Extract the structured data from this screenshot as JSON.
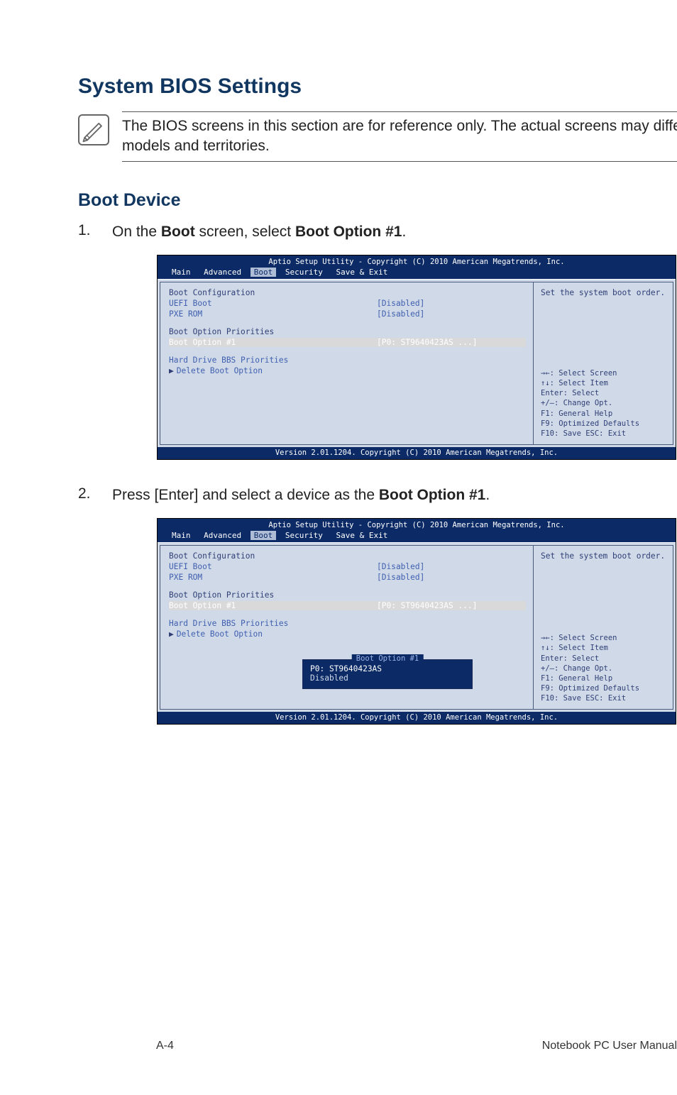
{
  "section_title": "System BIOS Settings",
  "note_text": "The BIOS screens in this section are for reference only. The actual screens may differ by models and territories.",
  "sub_title": "Boot Device",
  "steps": {
    "s1_num": "1.",
    "s1_pre": "On the ",
    "s1_b1": "Boot",
    "s1_mid": " screen, select ",
    "s1_b2": "Boot Option #1",
    "s1_post": ".",
    "s2_num": "2.",
    "s2_pre": "Press [Enter] and select a device as the ",
    "s2_b1": "Boot Option #1",
    "s2_post": "."
  },
  "bios": {
    "header": "Aptio Setup Utility - Copyright (C) 2010 American Megatrends, Inc.",
    "tabs": {
      "main": "Main",
      "advanced": "Advanced",
      "boot": "Boot",
      "security": "Security",
      "save": "Save & Exit"
    },
    "labels": {
      "boot_config": "Boot Configuration",
      "uefi_boot": "UEFI Boot",
      "pxe_rom": "PXE ROM",
      "priorities": "Boot Option Priorities",
      "boot_opt1": "Boot Option #1",
      "hard_drive_bbs": "Hard Drive BBS Priorities",
      "delete_boot": "Delete Boot Option"
    },
    "values": {
      "disabled": "[Disabled]",
      "boot_opt1_val": "[P0: ST9640423AS  ...]"
    },
    "side_text": "Set the system boot order.",
    "keys": {
      "k1": "→←: Select Screen",
      "k2": "↑↓:   Select Item",
      "k3": "Enter: Select",
      "k4": "+/—:  Change Opt.",
      "k5": "F1:   General Help",
      "k6": "F9:   Optimized Defaults",
      "k7": "F10:  Save   ESC: Exit"
    },
    "footer": "Version 2.01.1204. Copyright (C) 2010 American Megatrends, Inc.",
    "popup": {
      "title": "Boot Option #1",
      "opt1": "P0: ST9640423AS",
      "opt2": "Disabled"
    }
  },
  "page_footer": {
    "left": "A-4",
    "right": "Notebook PC User Manual"
  }
}
